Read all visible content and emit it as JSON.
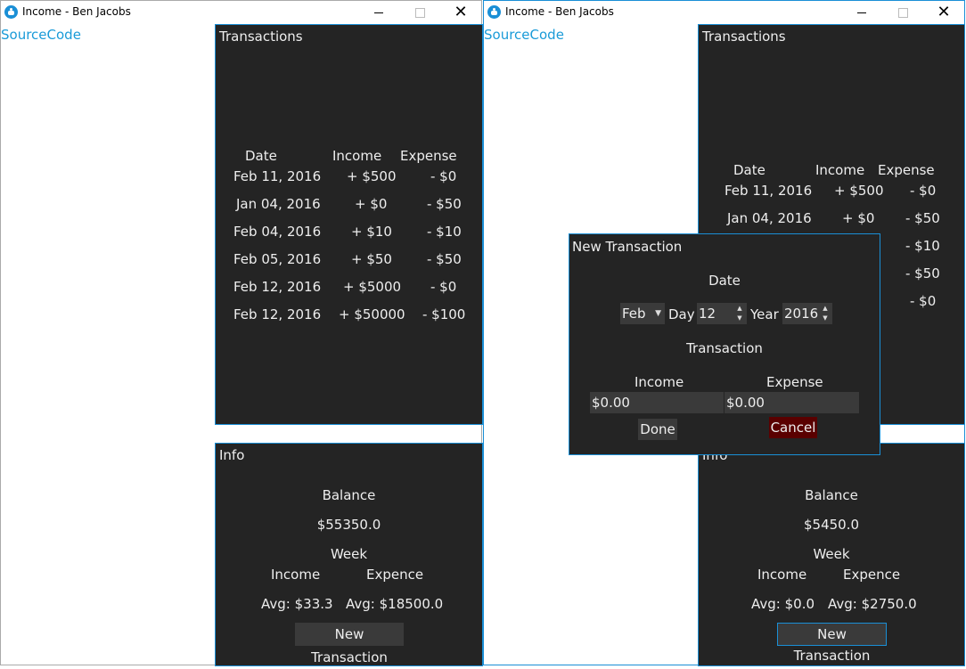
{
  "windows": [
    {
      "title": "Income - Ben Jacobs",
      "link": "SourceCode",
      "transactions": {
        "title": "Transactions",
        "headers": [
          "Date",
          "Income",
          "Expense"
        ],
        "rows": [
          [
            "Feb 11, 2016",
            "+ $500",
            "- $0"
          ],
          [
            "Jan 04, 2016",
            "+ $0",
            "- $50"
          ],
          [
            "Feb 04, 2016",
            "+ $10",
            "- $10"
          ],
          [
            "Feb 05, 2016",
            "+ $50",
            "- $50"
          ],
          [
            "Feb 12, 2016",
            "+ $5000",
            "- $0"
          ],
          [
            "Feb 12, 2016",
            "+ $50000",
            "- $100"
          ]
        ]
      },
      "info": {
        "title": "Info",
        "balance_label": "Balance",
        "balance": "$55350.0",
        "week_label": "Week",
        "income_label": "Income",
        "expense_label": "Expence",
        "avg_income": "Avg: $33.3",
        "avg_expense": "Avg: $18500.0",
        "new_button": "New Transaction"
      }
    },
    {
      "title": "Income - Ben Jacobs",
      "link": "SourceCode",
      "transactions": {
        "title": "Transactions",
        "headers": [
          "Date",
          "Income",
          "Expense"
        ],
        "rows": [
          [
            "Feb 11, 2016",
            "+ $500",
            "- $0"
          ],
          [
            "Jan 04, 2016",
            "+ $0",
            "- $50"
          ],
          [
            "",
            "",
            "- $10"
          ],
          [
            "",
            "",
            "- $50"
          ],
          [
            "",
            "",
            "- $0"
          ]
        ]
      },
      "info": {
        "title": "Info",
        "balance_label": "Balance",
        "balance": "$5450.0",
        "week_label": "Week",
        "income_label": "Income",
        "expense_label": "Expence",
        "avg_income": "Avg: $0.0",
        "avg_expense": "Avg: $2750.0",
        "new_button": "New Transaction"
      }
    }
  ],
  "dialog": {
    "title": "New Transaction",
    "date_label": "Date",
    "month": "Feb",
    "day_label": "Day",
    "day": "12",
    "year_label": "Year",
    "year": "2016",
    "transaction_label": "Transaction",
    "income_label": "Income",
    "expense_label": "Expense",
    "income_value": "$0.00",
    "expense_value": "$0.00",
    "done": "Done",
    "cancel": "Cancel"
  },
  "window_controls": {
    "close": "✕"
  },
  "colors": {
    "accent": "#1a8fd6",
    "panel": "#242424",
    "cancel": "#5a0000"
  }
}
